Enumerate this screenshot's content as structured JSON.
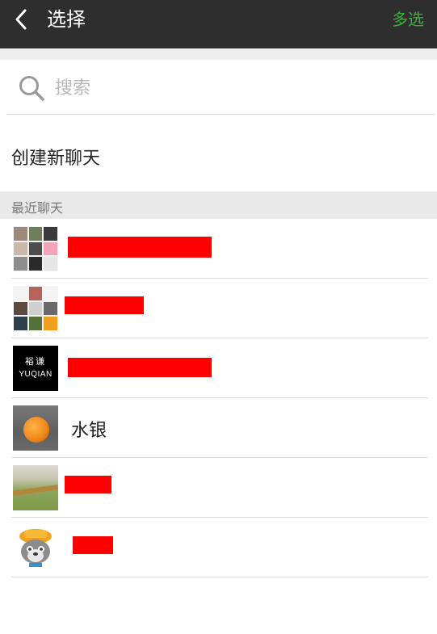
{
  "titlebar": {
    "title": "选择",
    "multi_select_label": "多选"
  },
  "search": {
    "placeholder": "搜索"
  },
  "new_chat": {
    "label": "创建新聊天"
  },
  "section": {
    "label": "最近聊天"
  },
  "chats": [
    {
      "name": "",
      "redacted": true
    },
    {
      "name": "",
      "redacted": true
    },
    {
      "name": "",
      "redacted": true,
      "avatar_text": [
        "裕谦",
        "YUQIAN"
      ]
    },
    {
      "name": "水银",
      "redacted": false
    },
    {
      "name": "",
      "redacted": true
    },
    {
      "name": "",
      "redacted": true
    }
  ],
  "colors": {
    "titlebar_bg": "#2e2e2e",
    "accent_green": "#35b43a",
    "redaction": "#ff0000"
  }
}
